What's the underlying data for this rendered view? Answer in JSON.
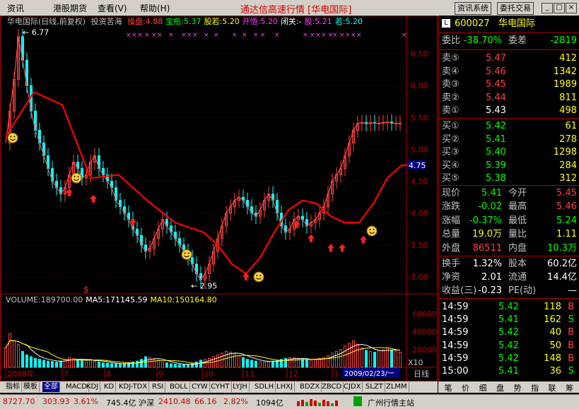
{
  "menu": [
    "资讯",
    "港股期货",
    "查看(V)",
    "帮助(H)"
  ],
  "app_title": "通达信高速行情 [华电国际]",
  "top_buttons": [
    "资讯系统",
    "委托交易"
  ],
  "window_controls": [
    "_",
    "□",
    "×"
  ],
  "colors": {
    "up": "#ff4040",
    "down": "#00ff00",
    "ma": "#ff0000",
    "yellow": "#ffff00",
    "cyan": "#00ffff",
    "magenta": "#ff40ff",
    "white": "#ffffff",
    "grid": "#b00000"
  },
  "legend": {
    "stock": "华电国际(日线,前复权)",
    "info": "投资苦海",
    "items": [
      {
        "text": "操盘:4.88",
        "color": "#ff4040"
      },
      {
        "text": "宝瓶:5.37",
        "color": "#00ff00"
      },
      {
        "text": "股若:5.20",
        "color": "#ffff00"
      },
      {
        "text": "开悟:5.20",
        "color": "#ff40ff"
      },
      {
        "text": "闭关:-",
        "color": "#ffffff"
      },
      {
        "text": "股:5.21",
        "color": "#ff40ff"
      },
      {
        "text": "若:5.20",
        "color": "#00ffff"
      }
    ]
  },
  "price_axis": {
    "ticks": [
      "6.50",
      "6.00",
      "5.50",
      "5.00",
      "4.50",
      "4.00",
      "3.50",
      "3.00"
    ],
    "current": "4.75"
  },
  "annotations": {
    "high": "6.77",
    "low": "2.95",
    "dollar": "$"
  },
  "volume": {
    "legend": [
      {
        "text": "VOLUME:189700.00",
        "color": "#c0c0c0"
      },
      {
        "text": "MA5:171145.59",
        "color": "#ffffff"
      },
      {
        "text": "MA10:150164.80",
        "color": "#ffff00"
      }
    ],
    "axis_ticks": [
      "60000",
      "40000",
      "20000"
    ],
    "unit": "X10"
  },
  "x_axis": {
    "labels": [
      "2008年",
      "7",
      "8",
      "9",
      "10",
      "11",
      "12",
      "1"
    ],
    "date_box": "2009/02/23/一",
    "period": "日线"
  },
  "chart_data": {
    "type": "line",
    "title": "华电国际(日线,前复权)",
    "ylim": [
      2.8,
      6.9
    ],
    "close_x": [
      0,
      6,
      12,
      18,
      24,
      30,
      36,
      42,
      48,
      54,
      60,
      66,
      72,
      78,
      84,
      90,
      96,
      102,
      108,
      114,
      120,
      126,
      132,
      138,
      144,
      150,
      156,
      162,
      168,
      174,
      180,
      186,
      192,
      198,
      204,
      210,
      216,
      222,
      228,
      234,
      240,
      246,
      252,
      258,
      264,
      270,
      276,
      282,
      288,
      294,
      300,
      306,
      312,
      318,
      324,
      330,
      336,
      342,
      348,
      354,
      360,
      366,
      372,
      378,
      384,
      390,
      396,
      402,
      408,
      414,
      420,
      426,
      432,
      438,
      444,
      450,
      456,
      462,
      468,
      474,
      480,
      486,
      492,
      498,
      504,
      510,
      516,
      522,
      528,
      534,
      540,
      546,
      552,
      558
    ],
    "close": [
      5.1,
      5.6,
      6.1,
      6.77,
      6.4,
      6.0,
      5.6,
      5.3,
      5.1,
      4.9,
      4.7,
      4.5,
      4.4,
      4.3,
      4.4,
      4.6,
      4.8,
      4.7,
      4.55,
      4.6,
      4.8,
      4.9,
      4.7,
      4.6,
      4.5,
      4.4,
      4.2,
      4.1,
      4.0,
      3.9,
      3.75,
      3.65,
      3.5,
      3.4,
      3.45,
      3.6,
      3.75,
      3.9,
      3.8,
      3.7,
      3.6,
      3.5,
      3.4,
      3.3,
      3.2,
      3.05,
      2.95,
      3.05,
      3.2,
      3.4,
      3.6,
      3.8,
      4.0,
      4.1,
      4.2,
      4.25,
      4.2,
      4.1,
      4.0,
      3.95,
      4.05,
      4.2,
      4.3,
      4.2,
      4.0,
      3.8,
      3.7,
      3.75,
      3.9,
      3.95,
      3.9,
      3.8,
      3.85,
      3.9,
      4.0,
      4.1,
      4.3,
      4.5,
      4.6,
      4.7,
      4.9,
      5.1,
      5.3,
      5.41,
      5.42,
      5.4,
      5.42,
      5.41,
      5.41,
      5.42,
      5.43,
      5.41,
      5.41,
      5.41
    ],
    "ma_x": [
      0,
      40,
      80,
      120,
      160,
      200,
      240,
      280,
      300,
      320,
      340,
      360,
      380,
      400,
      420,
      440,
      460,
      480,
      500,
      520,
      540,
      560,
      570
    ],
    "ma": [
      5.2,
      5.9,
      5.7,
      4.55,
      4.6,
      4.2,
      3.85,
      3.7,
      3.5,
      3.2,
      3.05,
      3.3,
      3.7,
      4.05,
      4.2,
      4.15,
      3.95,
      3.85,
      3.85,
      4.15,
      4.55,
      4.75,
      4.75
    ],
    "volume_x": [
      0,
      6,
      12,
      18,
      24,
      30,
      36,
      42,
      48,
      54,
      60,
      66,
      72,
      78,
      84,
      90,
      96,
      102,
      108,
      114,
      120,
      126,
      132,
      138,
      144,
      150,
      156,
      162,
      168,
      174,
      180,
      186,
      192,
      198,
      204,
      210,
      216,
      222,
      228,
      234,
      240,
      246,
      252,
      258,
      264,
      270,
      276,
      282,
      288,
      294,
      300,
      306,
      312,
      318,
      324,
      330,
      336,
      342,
      348,
      354,
      360,
      366,
      372,
      378,
      384,
      390,
      396,
      402,
      408,
      414,
      420,
      426,
      432,
      438,
      444,
      450,
      456,
      462,
      468,
      474,
      480,
      486,
      492,
      498,
      504,
      510,
      516,
      522,
      528,
      534,
      540,
      546,
      552,
      558
    ],
    "volume": [
      22000,
      38000,
      30000,
      26000,
      18000,
      14000,
      12000,
      10000,
      9000,
      8000,
      7000,
      6500,
      6000,
      7000,
      9000,
      11000,
      10000,
      8000,
      7500,
      8000,
      9000,
      7000,
      6000,
      5000,
      4500,
      4000,
      3800,
      3500,
      4200,
      5000,
      6000,
      7000,
      9000,
      12000,
      11000,
      9000,
      8000,
      6000,
      5000,
      4000,
      3500,
      3000,
      3000,
      3200,
      4000,
      6000,
      8000,
      9000,
      10000,
      12000,
      14000,
      16000,
      18000,
      17000,
      15000,
      13000,
      11000,
      9000,
      8000,
      7000,
      6500,
      6000,
      6200,
      7000,
      8000,
      9000,
      10000,
      11000,
      10500,
      9500,
      9000,
      8500,
      8000,
      9000,
      10000,
      11000,
      13000,
      16000,
      18000,
      20000,
      24000,
      27000,
      30000,
      26000,
      22000,
      19000,
      18000,
      17000,
      18970,
      20000,
      22000,
      19000,
      18000,
      17000
    ]
  },
  "quote": {
    "code": "600027",
    "name": "华电国际",
    "wei_bi_label": "委比",
    "wei_bi": "-38.70%",
    "wei_cha_label": "委差",
    "wei_cha": "-2819",
    "sells": [
      {
        "label": "卖⑤",
        "price": "5.47",
        "vol": "412"
      },
      {
        "label": "卖④",
        "price": "5.46",
        "vol": "1342"
      },
      {
        "label": "卖③",
        "price": "5.45",
        "vol": "1989"
      },
      {
        "label": "卖②",
        "price": "5.44",
        "vol": "811"
      },
      {
        "label": "卖①",
        "price": "5.43",
        "vol": "498"
      }
    ],
    "buys": [
      {
        "label": "买①",
        "price": "5.42",
        "vol": "61"
      },
      {
        "label": "买②",
        "price": "5.41",
        "vol": "278"
      },
      {
        "label": "买③",
        "price": "5.40",
        "vol": "1298"
      },
      {
        "label": "买④",
        "price": "5.39",
        "vol": "284"
      },
      {
        "label": "买⑤",
        "price": "5.38",
        "vol": "312"
      }
    ],
    "stats": [
      {
        "l1": "现价",
        "v1": "5.41",
        "c1": "#00ff00",
        "l2": "今开",
        "v2": "5.45",
        "c2": "#ff4040"
      },
      {
        "l1": "涨跌",
        "v1": "-0.02",
        "c1": "#00ff00",
        "l2": "最高",
        "v2": "5.46",
        "c2": "#ff4040"
      },
      {
        "l1": "涨幅",
        "v1": "-0.37%",
        "c1": "#00ff00",
        "l2": "最低",
        "v2": "5.24",
        "c2": "#00ff00"
      },
      {
        "l1": "总量",
        "v1": "19.0万",
        "c1": "#ffff00",
        "l2": "量比",
        "v2": "1.11",
        "c2": "#ffff00"
      },
      {
        "l1": "外盘",
        "v1": "86511",
        "c1": "#ff4040",
        "l2": "内盘",
        "v2": "10.3万",
        "c2": "#00ff00"
      }
    ],
    "fundamentals": [
      {
        "l1": "换手",
        "v1": "1.32%",
        "l2": "股本",
        "v2": "60.2亿"
      },
      {
        "l1": "净资",
        "v1": "2.01",
        "l2": "流通",
        "v2": "14.4亿"
      },
      {
        "l1": "收益(三)",
        "v1": "-0.23",
        "l2": "PE(动)",
        "v2": "—"
      }
    ],
    "ticks": [
      {
        "time": "14:59",
        "price": "5.42",
        "vol": "118",
        "side": "B"
      },
      {
        "time": "14:59",
        "price": "5.41",
        "vol": "162",
        "side": "S"
      },
      {
        "time": "14:59",
        "price": "5.42",
        "vol": "40",
        "side": "B"
      },
      {
        "time": "14:59",
        "price": "5.42",
        "vol": "50",
        "side": "B"
      },
      {
        "time": "14:59",
        "price": "5.42",
        "vol": "148",
        "side": "B"
      },
      {
        "time": "15:00",
        "price": "5.41",
        "vol": "36",
        "side": "S"
      }
    ]
  },
  "bottom_tabs": [
    "指标",
    "模板",
    "全部",
    "MACD",
    "KDJ",
    "KD",
    "KDJ-TDX",
    "RSI",
    "BOLL",
    "CYW",
    "CYHT",
    "LYJH",
    "SDLH",
    "LHXJ",
    "BDZX",
    "ZBCD",
    "CJDX",
    "SLZT",
    "ZLMM"
  ],
  "right_tabs": [
    "笔",
    "价",
    "细",
    "盘",
    "势",
    "指",
    "联",
    "筹"
  ],
  "status": {
    "sh_index": "8727.70",
    "sh_change": "303.93",
    "sh_pct": "3.61%",
    "sh_amount": "745.4亿",
    "sz_label": "沪深",
    "sz_index": "2410.48",
    "sz_change": "66.16",
    "sz_pct": "2.82%",
    "sz_amount": "1094亿",
    "server": "广州行情主站"
  }
}
